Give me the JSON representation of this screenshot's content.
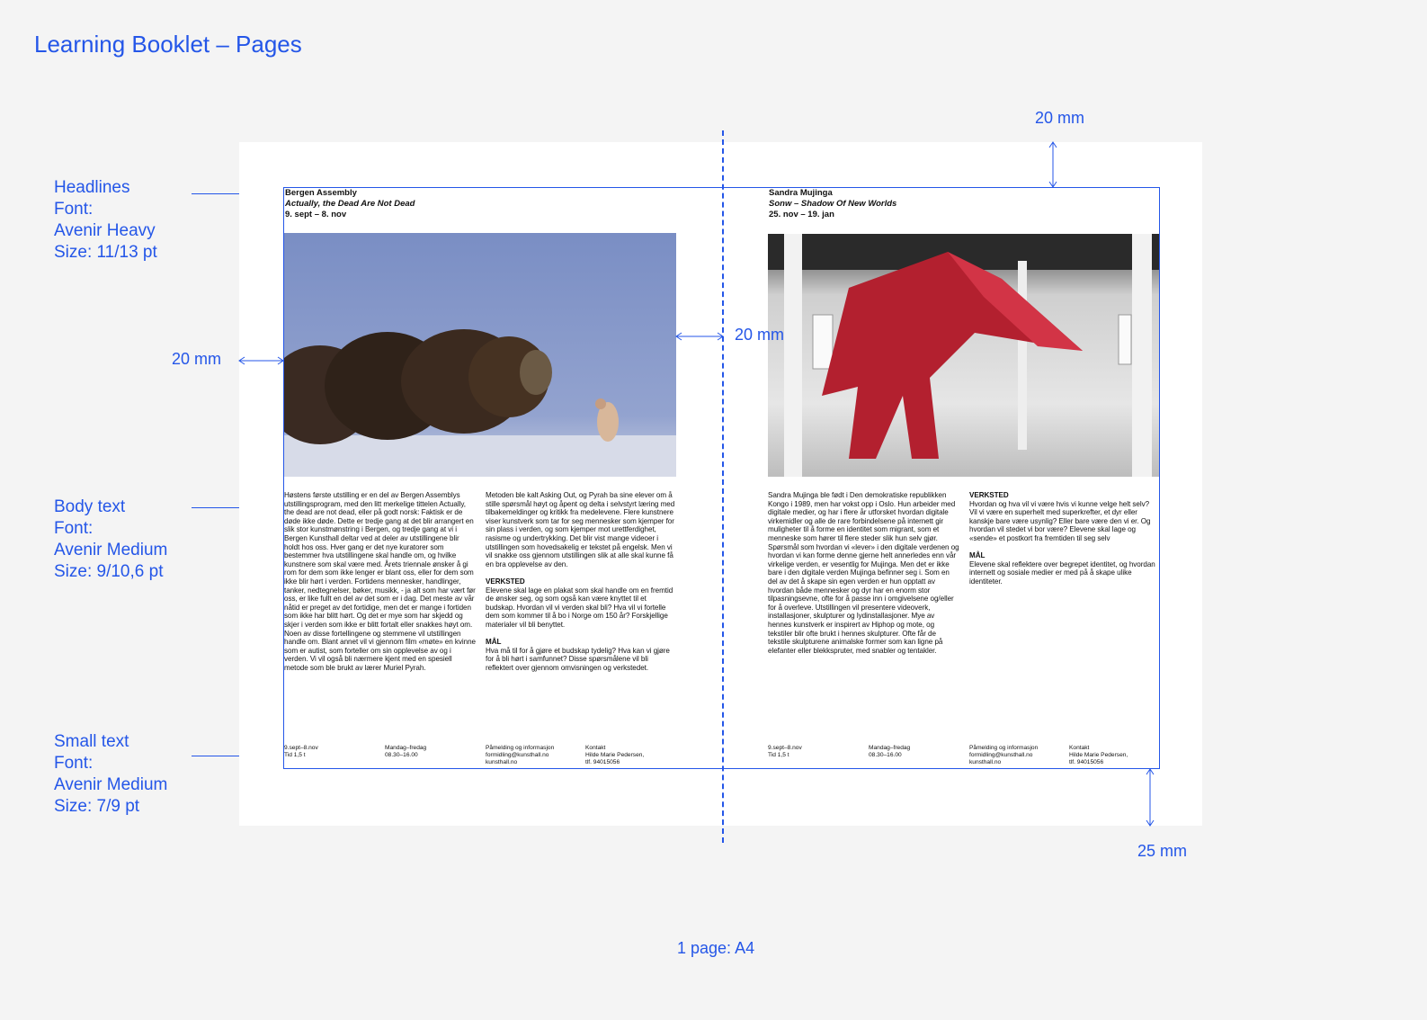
{
  "title": "Learning Booklet  – Pages",
  "annotations": {
    "headlines": [
      "Headlines",
      "Font:",
      "Avenir Heavy",
      "Size: 11/13 pt"
    ],
    "body": [
      "Body text",
      "Font:",
      "Avenir Medium",
      "Size: 9/10,6 pt"
    ],
    "small": [
      "Small text",
      "Font:",
      "Avenir Medium",
      "Size: 7/9 pt"
    ],
    "margin_top": "20 mm",
    "margin_outer": "20 mm",
    "margin_inner": "20 mm",
    "margin_bottom": "25 mm",
    "page_size": "1 page: A4"
  },
  "colors": {
    "accent": "#2456e8"
  },
  "left_page": {
    "artist": "Bergen Assembly",
    "exhibition": "Actually, the Dead Are Not Dead",
    "dates": "9. sept – 8. nov",
    "image": "musk-oxen-photo",
    "col1": [
      "Høstens første utstilling er en del av Bergen Assemblys utstillingsprogram, med den litt merkelige tittelen Actually, the dead are not dead, eller på godt norsk: Faktisk er de døde ikke døde. Dette er tredje gang at det blir arrangert en slik stor kunstmønstring i Bergen, og tredje gang at vi i Bergen Kunsthall deltar ved at deler av utstillingene blir holdt hos oss. Hver gang er det nye kuratorer som bestemmer hva utstillingene skal handle om, og hvilke kunstnere som skal være med. Årets triennale ønsker å gi rom for dem som ikke lenger er blant oss, eller for dem som ikke blir hørt i verden. Fortidens mennesker, handlinger, tanker, nedtegnelser, bøker, musikk, - ja alt som har vært før oss, er like fullt en del av det som er i dag. Det meste av vår nåtid er preget av det fortidige, men det er mange i fortiden som ikke har blitt hørt. Og det er mye som har skjedd og skjer i verden som ikke er blitt fortalt eller snakkes høyt om. Noen av disse fortellingene og stemmene vil utstillingen handle om. Blant annet vil vi gjennom film «møte» en kvinne som er autist, som forteller om sin opplevelse av og i verden. Vi vil også bli nærmere kjent med en spesiell metode som ble brukt av lærer Muriel Pyrah."
    ],
    "col2": [
      {
        "h": "",
        "t": "Metoden ble kalt Asking Out, og Pyrah ba sine elever om å stille spørsmål høyt og åpent og delta i selvstyrt læring med tilbakemeldinger og kritikk fra medelevene. Flere kunstnere viser kunstverk som tar for seg mennesker som kjemper for sin plass i verden, og som kjemper mot urettferdighet, rasisme og undertrykking. Det blir vist mange videoer i utstillingen som hovedsakelig er tekstet på engelsk. Men vi vil snakke oss gjennom utstillingen slik at alle skal kunne få en bra opplevelse av den."
      },
      {
        "h": "VERKSTED",
        "t": "Elevene skal lage en plakat som skal handle om en fremtid de ønsker seg, og som også kan være knyttet til et budskap. Hvordan vil vi verden skal bli? Hva vil vi fortelle dem som kommer til å bo i Norge om 150 år? Forskjellige materialer vil bli benyttet."
      },
      {
        "h": "MÅL",
        "t": "Hva må til for å gjøre et budskap tydelig? Hva kan vi gjøre for å bli hørt i samfunnet? Disse spørsmålene vil bli reflektert over gjennom omvisningen og verkstedet."
      }
    ],
    "footer": [
      [
        "9.sept–8.nov",
        "Tid 1,5 t"
      ],
      [
        "Mandag–fredag",
        "08.30–16.00"
      ],
      [
        "Påmelding og informasjon",
        "formidling@kunsthall.no",
        "kunsthall.no"
      ],
      [
        "Kontakt",
        "Hilde Marie Pedersen,",
        "tlf. 94015056"
      ]
    ]
  },
  "right_page": {
    "artist": "Sandra Mujinga",
    "exhibition": "Sonw – Shadow Of New Worlds",
    "dates": "25. nov – 19. jan",
    "image": "red-textile-sculpture-photo",
    "col1": [
      "Sandra Mujinga ble født i Den demokratiske republikken Kongo i 1989, men har vokst opp i Oslo. Hun arbeider med digitale medier, og har i flere år utforsket hvordan digitale virkemidler og alle de rare forbindelsene på internett gir muligheter til å forme en identitet som migrant, som et menneske som hører til flere steder slik hun selv gjør. Spørsmål som hvordan vi «lever» i den digitale verdenen og hvordan vi kan forme denne gjerne helt annerledes enn vår virkelige verden, er vesentlig for Mujinga. Men det er ikke bare i den digitale verden Mujinga befinner seg i. Som en del av det å skape sin egen verden er hun opptatt av hvordan både mennesker og dyr har en enorm stor tilpasningsevne, ofte for å passe inn i omgivelsene og/eller for å overleve. Utstillingen vil presentere videoverk, installasjoner, skulpturer og lydinstallasjoner. Mye av hennes kunstverk er inspirert av Hiphop og mote, og tekstiler blir ofte brukt i hennes skulpturer. Ofte får de tekstile skulpturene animalske former som kan ligne på elefanter eller blekkspruter, med snabler og tentakler."
    ],
    "col2": [
      {
        "h": "VERKSTED",
        "t": "Hvordan og hva vil vi være hvis vi kunne velge helt selv? Vil vi være en superhelt med superkrefter, et dyr eller kanskje bare være usynlig? Eller bare være den vi er. Og hvordan vil stedet vi bor være? Elevene skal lage og «sende» et postkort fra fremtiden til seg selv"
      },
      {
        "h": "MÅL",
        "t": "Elevene skal reflektere over begrepet identitet, og hvordan internett og sosiale medier er med på å skape ulike identiteter."
      }
    ],
    "footer": [
      [
        "9.sept–8.nov",
        "Tid 1,5 t"
      ],
      [
        "Mandag–fredag",
        "08.30–16.00"
      ],
      [
        "Påmelding og informasjon",
        "formidling@kunsthall.no",
        "kunsthall.no"
      ],
      [
        "Kontakt",
        "Hilde Marie Pedersen,",
        "tlf. 94015056"
      ]
    ]
  }
}
